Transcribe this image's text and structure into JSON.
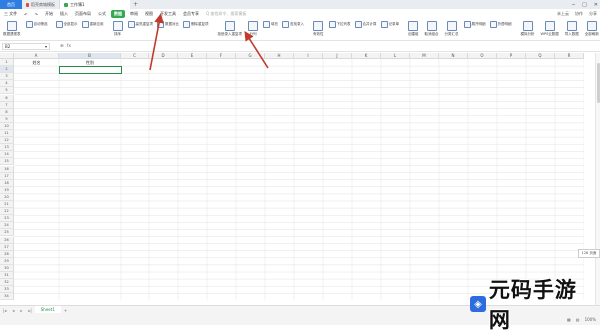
{
  "tabs": {
    "home": "首页",
    "doc1": "稻壳商城模板",
    "doc2": "工作簿1",
    "new": "+"
  },
  "menubar": {
    "items": [
      "三 文件",
      "↶",
      "↷",
      "开始",
      "插入",
      "页面布局",
      "公式",
      "数据",
      "审阅",
      "视图",
      "开发工具",
      "会员专享",
      "Q 查找命令、搜索模板"
    ],
    "active_index": 7,
    "right": [
      "未上云",
      "协作",
      "分享"
    ]
  },
  "toolbar": {
    "items": [
      "数据透视表",
      "自动筛选",
      "全部显示",
      "重新应用",
      "排序",
      "高亮重复项",
      "数据对比",
      "删除重复项",
      "拒绝录入重复项",
      "分列",
      "填充",
      "查找录入",
      "有效性",
      "下拉列表",
      "合并计算",
      "记录单",
      "创建组",
      "取消组合",
      "分类汇总",
      "展开明细",
      "折叠明细",
      "模拟分析",
      "WPS云数据",
      "导入数据",
      "全部刷新",
      "数据区域"
    ]
  },
  "formula": {
    "namebox": "B2",
    "fx": "fx"
  },
  "sheet": {
    "columns": [
      "A",
      "B",
      "C",
      "D",
      "E",
      "F",
      "G",
      "H",
      "I",
      "J",
      "K",
      "L",
      "M",
      "N",
      "O",
      "P",
      "Q",
      "R"
    ],
    "selected_column": "B",
    "rows": 34,
    "selected_row": 2,
    "cells": {
      "A1": "姓名",
      "B1": "性别"
    }
  },
  "sheetbar": {
    "tab": "Sheet1",
    "add": "+"
  },
  "zoom_tooltip": "126 页面",
  "status": {
    "zoom": "100%"
  },
  "watermark": {
    "text": "元码手游网"
  },
  "colors": {
    "accent": "#35a853",
    "home_tab": "#2f7de1",
    "arrow": "#c23a2b",
    "selection": "#2a8a4c"
  }
}
